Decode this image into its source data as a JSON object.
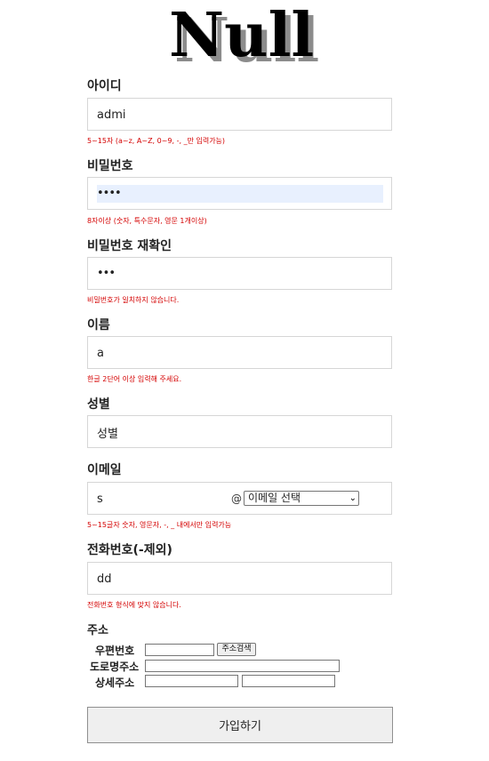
{
  "logo": {
    "text": "Null"
  },
  "form": {
    "id": {
      "label": "아이디",
      "value": "admi",
      "hint": "5~15자 (a~z, A~Z, 0~9, -, _만 입력가능)"
    },
    "password": {
      "label": "비밀번호",
      "value": "••••",
      "hint": "8자이상 (숫자, 특수문자, 영문 1개이상)"
    },
    "password_confirm": {
      "label": "비밀번호 재확인",
      "value": "•••",
      "hint": "비밀번호가 일치하지 않습니다."
    },
    "name": {
      "label": "이름",
      "value": "a",
      "hint": "한글 2단어 이상 입력해 주세요."
    },
    "gender": {
      "label": "성별",
      "value": "성별"
    },
    "email": {
      "label": "이메일",
      "value": "s",
      "at": "@",
      "domain_selected": "이메일 선택",
      "hint": "5~15글자 숫자, 영문자, -, _ 내에서만 입력가능"
    },
    "phone": {
      "label": "전화번호(-제외)",
      "value": "dd",
      "hint": "전화번호 형식에 맞지 않습니다."
    },
    "address": {
      "title": "주소",
      "zip_label": "우편번호",
      "search_button": "주소검색",
      "road_label": "도로명주소",
      "detail_label": "상세주소"
    },
    "submit_label": "가입하기"
  }
}
